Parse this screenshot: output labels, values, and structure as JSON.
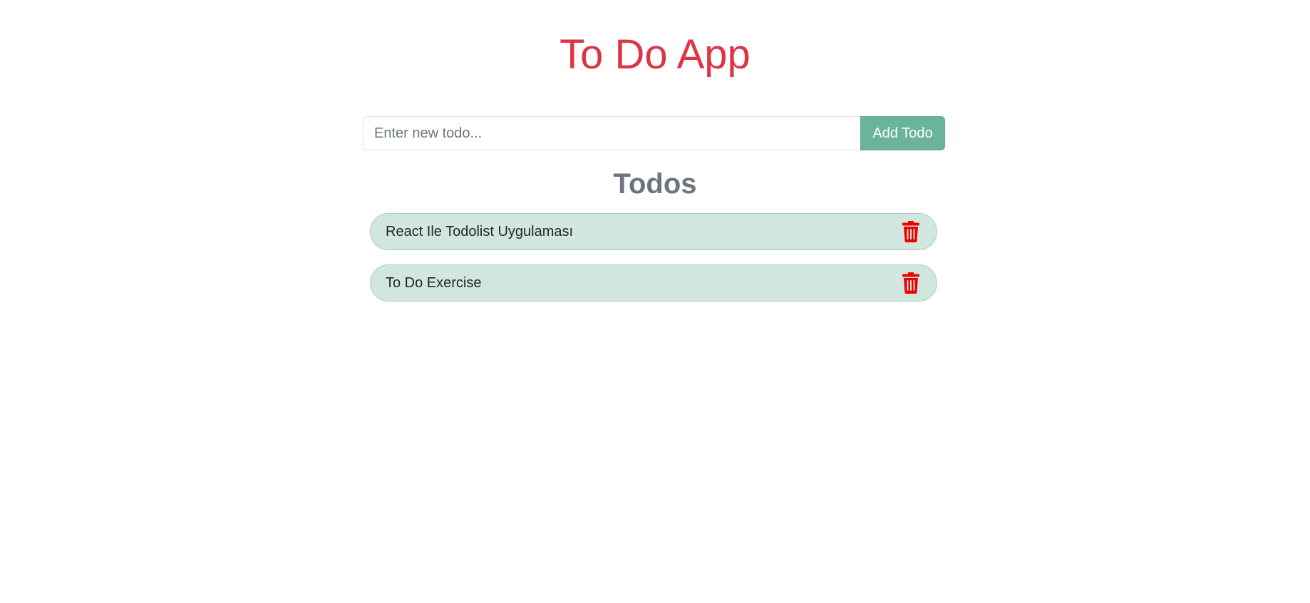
{
  "header": {
    "title": "To Do App"
  },
  "form": {
    "placeholder": "Enter new todo...",
    "value": "",
    "add_label": "Add Todo"
  },
  "list": {
    "title": "Todos",
    "items": [
      {
        "text": "React Ile Todolist Uygulaması"
      },
      {
        "text": "To Do Exercise"
      }
    ]
  },
  "icons": {
    "delete": "trash-icon"
  },
  "colors": {
    "title": "#dc3545",
    "button": "#6bb39a",
    "item_bg": "#d1e7dd",
    "item_border": "#a7cfbf",
    "delete_icon": "#ee0000",
    "section_title": "#6c757d"
  }
}
